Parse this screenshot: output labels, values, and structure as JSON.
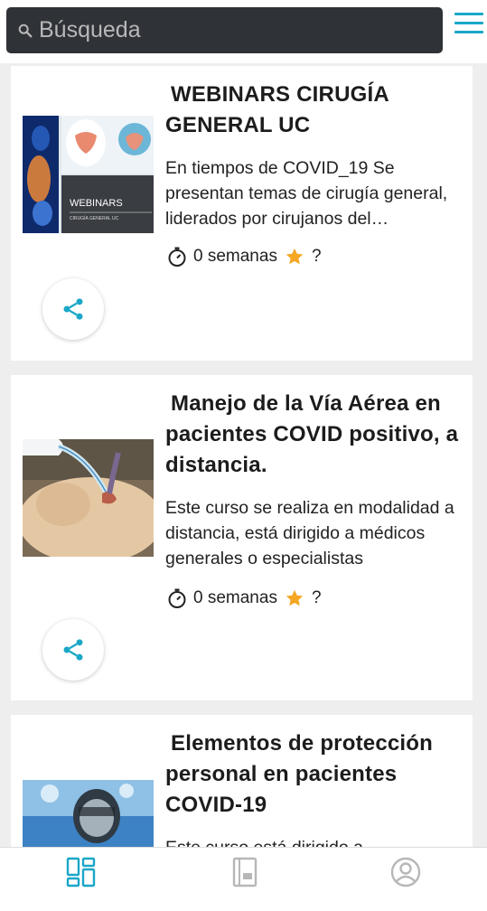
{
  "search": {
    "placeholder": "Búsqueda"
  },
  "menu": {
    "icon": "hamburger-menu-icon",
    "color": "#1aa7c8"
  },
  "courses": [
    {
      "title": "WEBINARS CIRUGÍA GENERAL UC",
      "description": "En tiempos de COVID_19 Se presentan temas de cirugía general, liderados por cirujanos del departamento de cirugía UC",
      "duration": "0 semanas",
      "rating": "?",
      "thumb_text": "WEBINARS",
      "thumb_subtext": "CIRUGÍA GENERAL UC"
    },
    {
      "title": "Manejo de la Vía Aérea en pacientes COVID positivo, a distancia.",
      "description": "Este curso se realiza en modalidad a distancia, está dirigido a médicos generales o especialistas",
      "duration": "0 semanas",
      "rating": "?"
    },
    {
      "title": "Elementos de protección personal en pacientes COVID-19",
      "description": "Este curso está dirigido a"
    }
  ],
  "bottom_nav": [
    {
      "icon": "dashboard-icon",
      "active": true
    },
    {
      "icon": "book-icon",
      "active": false
    },
    {
      "icon": "user-profile-icon",
      "active": false
    }
  ],
  "colors": {
    "accent": "#1aa7c8",
    "star": "#f5a623",
    "search_bg": "#2f3237"
  }
}
